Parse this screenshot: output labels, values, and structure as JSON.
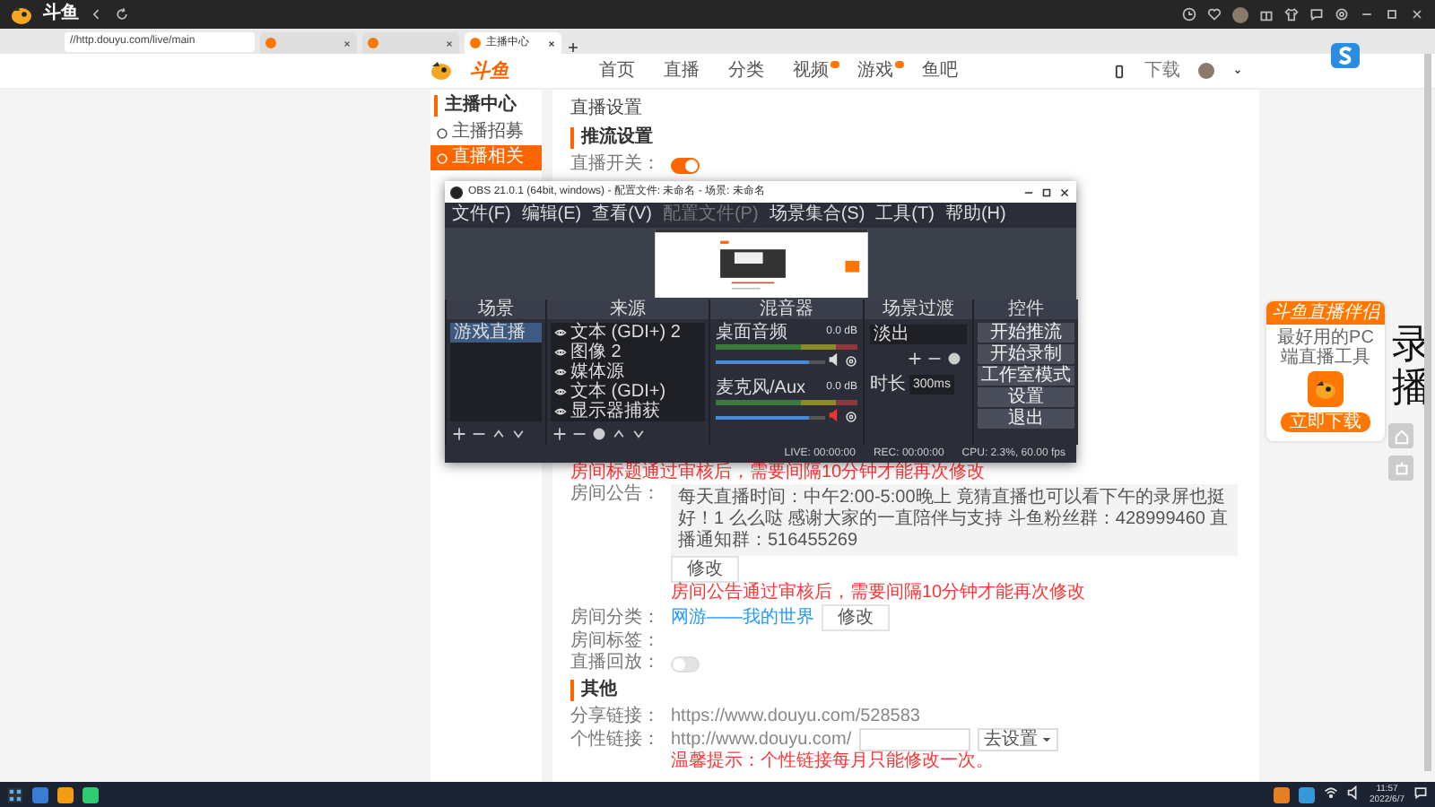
{
  "browser": {
    "logo_text": "斗鱼",
    "address": "//http.douyu.com/live/main",
    "tabs": [
      {
        "selected": false
      },
      {
        "selected": false
      },
      {
        "title": "主播中心",
        "selected": true
      }
    ]
  },
  "site": {
    "logo_text": "斗鱼",
    "nav": [
      {
        "label": "首页",
        "badge": false
      },
      {
        "label": "直播",
        "badge": false
      },
      {
        "label": "分类",
        "badge": false
      },
      {
        "label": "视频",
        "badge": true
      },
      {
        "label": "游戏",
        "badge": true
      },
      {
        "label": "鱼吧",
        "badge": false
      }
    ],
    "download": "下载"
  },
  "sidebar": {
    "title": "主播中心",
    "items": [
      {
        "label": "主播招募",
        "selected": false
      },
      {
        "label": "直播相关",
        "selected": true
      }
    ]
  },
  "content": {
    "title": "直播设置",
    "section": "推流设置",
    "switch": {
      "label": "直播开关：",
      "on": true
    }
  },
  "obs": {
    "title": "OBS 21.0.1 (64bit, windows) - 配置文件: 未命名 - 场景: 未命名",
    "menu": [
      {
        "label": "文件(F)",
        "disabled": false
      },
      {
        "label": "编辑(E)",
        "disabled": false
      },
      {
        "label": "查看(V)",
        "disabled": false
      },
      {
        "label": "配置文件(P)",
        "disabled": true
      },
      {
        "label": "场景集合(S)",
        "disabled": false
      },
      {
        "label": "工具(T)",
        "disabled": false
      },
      {
        "label": "帮助(H)",
        "disabled": false
      }
    ],
    "docks": [
      "场景",
      "来源",
      "混音器",
      "场景过渡",
      "控件"
    ],
    "scenes": [
      {
        "label": "游戏直播",
        "selected": true
      }
    ],
    "sources": [
      "文本 (GDI+) 2",
      "图像 2",
      "媒体源",
      "文本 (GDI+)",
      "显示器捕获"
    ],
    "mixer": [
      {
        "name": "桌面音频",
        "reading": "0.0 dB",
        "level": 0.85,
        "muted": false
      },
      {
        "name": "麦克风/Aux",
        "reading": "0.0 dB",
        "level": 0.85,
        "muted": true
      }
    ],
    "transition": {
      "value": "淡出",
      "duration_label": "时长",
      "duration": "300ms"
    },
    "controls": [
      "开始推流",
      "开始录制",
      "工作室模式",
      "设置",
      "退出"
    ],
    "status": [
      "LIVE: 00:00:00",
      "REC: 00:00:00",
      "CPU: 2.3%, 60.00 fps"
    ]
  },
  "form": {
    "title_note": "房间标题通过审核后，需要间隔10分钟才能再次修改",
    "announcement": {
      "label": "房间公告：",
      "text": "每天直播时间：中午2:00-5:00晚上 竟猜直播也可以看下午的录屏也挺好！1 么么哒 感谢大家的一直陪伴与支持 斗鱼粉丝群：428999460 直播通知群：516455269",
      "button": "修改",
      "note": "房间公告通过审核后，需要间隔10分钟才能再次修改"
    },
    "category": {
      "label": "房间分类：",
      "value": "网游——我的世界",
      "button": "修改"
    },
    "tags": {
      "label": "房间标签："
    },
    "replay": {
      "label": "直播回放：",
      "on": false
    }
  },
  "other": {
    "title": "其他",
    "share": {
      "label": "分享链接：",
      "value": "https://www.douyu.com/528583"
    },
    "custom": {
      "label": "个性链接：",
      "prefix": "http://www.douyu.com/",
      "button": "去设置",
      "tip": "温馨提示：个性链接每月只能修改一次。"
    }
  },
  "promo": {
    "title": "斗鱼直播伴侣",
    "subtitle": "最好用的PC端直播工具",
    "button": "立即下载"
  },
  "overlay_text": "录播",
  "taskbar": {
    "time": "11:57",
    "date": "2022/6/7"
  }
}
